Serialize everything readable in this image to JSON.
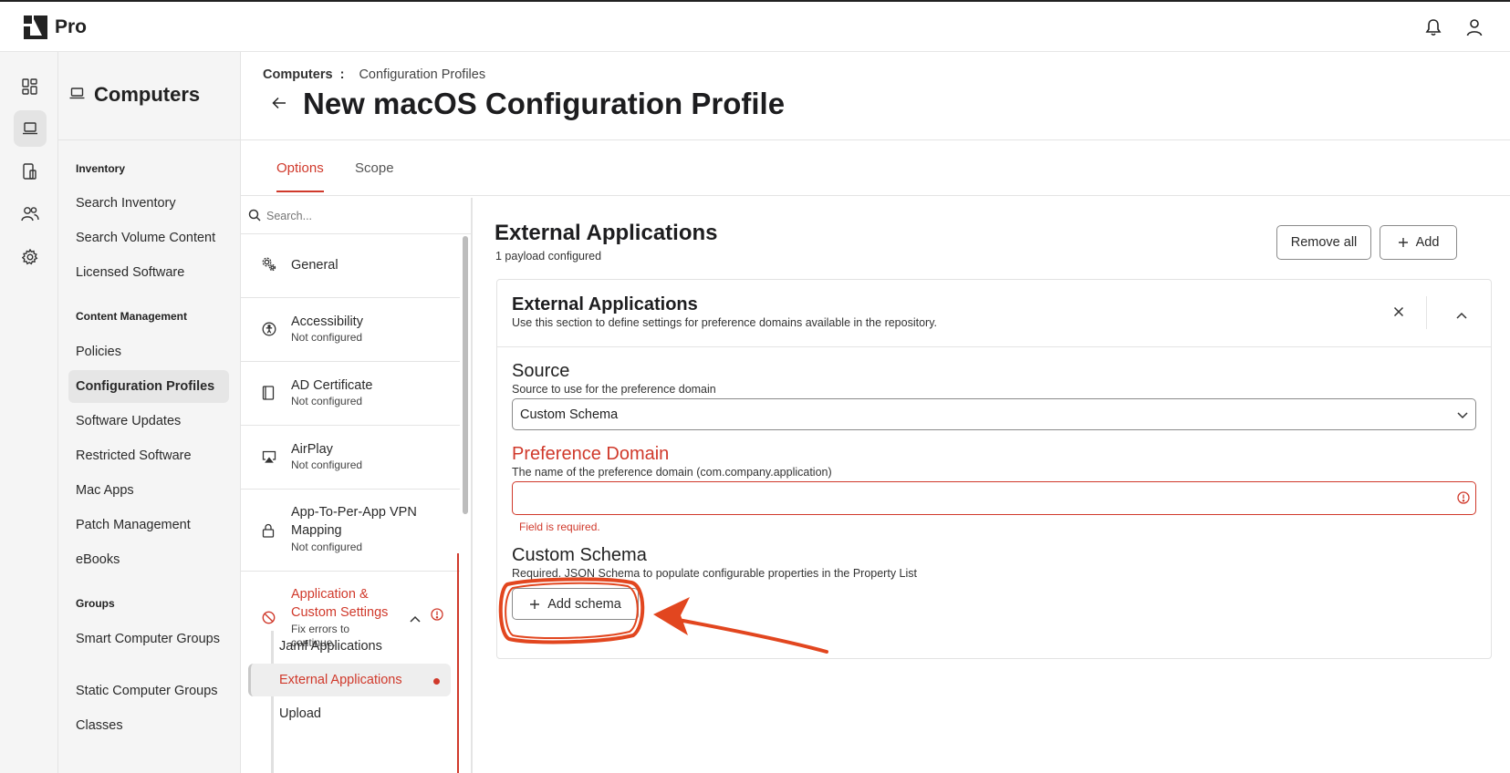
{
  "app": {
    "name": "Pro"
  },
  "sidenav": {
    "title": "Computers",
    "sections": [
      {
        "label": "Inventory",
        "items": [
          "Search Inventory",
          "Search Volume Content",
          "Licensed Software"
        ]
      },
      {
        "label": "Content Management",
        "items": [
          "Policies",
          "Configuration Profiles",
          "Software Updates",
          "Restricted Software",
          "Mac Apps",
          "Patch Management",
          "eBooks"
        ]
      },
      {
        "label": "Groups",
        "items": [
          "Smart Computer Groups",
          "Static Computer Groups",
          "Classes"
        ]
      }
    ],
    "active_item": "Configuration Profiles"
  },
  "breadcrumb": {
    "parent": "Computers",
    "separator": ":",
    "current": "Configuration Profiles"
  },
  "page_title": "New macOS Configuration Profile",
  "tabs": [
    {
      "label": "Options",
      "active": true
    },
    {
      "label": "Scope",
      "active": false
    }
  ],
  "payload_list": {
    "search_placeholder": "Search...",
    "items": [
      {
        "name": "General",
        "status": ""
      },
      {
        "name": "Accessibility",
        "status": "Not configured"
      },
      {
        "name": "AD Certificate",
        "status": "Not configured"
      },
      {
        "name": "AirPlay",
        "status": "Not configured"
      },
      {
        "name": "App-To-Per-App VPN Mapping",
        "status": "Not configured"
      },
      {
        "name": "Application & Custom Settings",
        "status": "Fix errors to continue."
      }
    ],
    "sub_items": [
      "Jamf Applications",
      "External Applications",
      "Upload"
    ]
  },
  "content": {
    "title": "External Applications",
    "subtitle": "1 payload configured",
    "remove_all_label": "Remove all",
    "add_label": "Add",
    "card": {
      "title": "External Applications",
      "description": "Use this section to define settings for preference domains available in the repository.",
      "source": {
        "label": "Source",
        "help": "Source to use for the preference domain",
        "value": "Custom Schema"
      },
      "preference_domain": {
        "label": "Preference Domain",
        "help": "The name of the preference domain (com.company.application)",
        "value": "",
        "error": "Field is required."
      },
      "custom_schema": {
        "label": "Custom Schema",
        "help": "Required. JSON Schema to populate configurable properties in the Property List",
        "button_label": "Add schema"
      }
    }
  },
  "colors": {
    "accent": "#d0392b",
    "annotation": "#e2461f"
  }
}
